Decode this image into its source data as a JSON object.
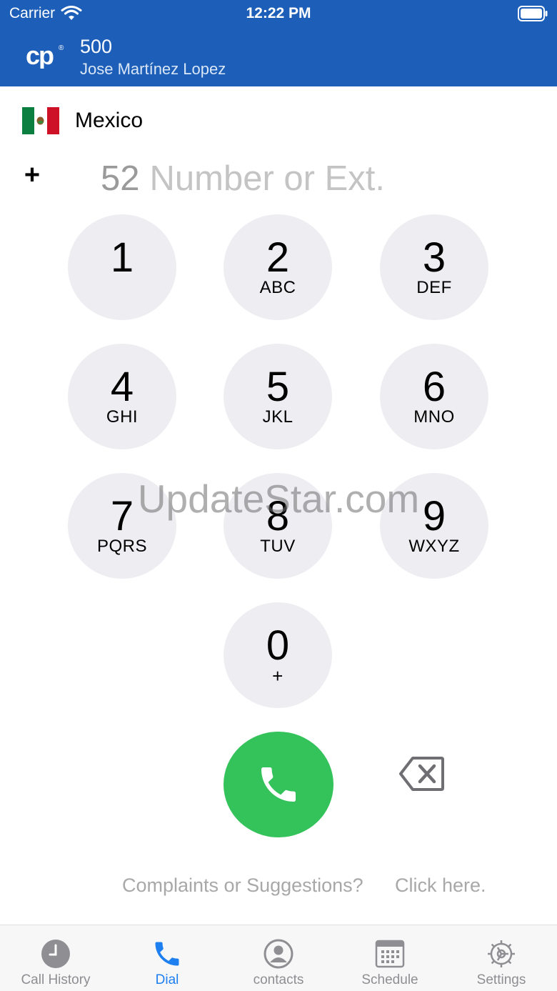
{
  "status_bar": {
    "carrier": "Carrier",
    "time": "12:22 PM"
  },
  "account": {
    "extension": "500",
    "name": "Jose Martínez Lopez"
  },
  "country": {
    "name": "Mexico",
    "code": "52",
    "flag_colors": [
      "#0a7f3f",
      "#ffffff",
      "#ce1126"
    ]
  },
  "dialer": {
    "plus_symbol": "+",
    "placeholder": "Number or Ext.",
    "value": ""
  },
  "keypad": [
    {
      "digit": "1",
      "letters": ""
    },
    {
      "digit": "2",
      "letters": "ABC"
    },
    {
      "digit": "3",
      "letters": "DEF"
    },
    {
      "digit": "4",
      "letters": "GHI"
    },
    {
      "digit": "5",
      "letters": "JKL"
    },
    {
      "digit": "6",
      "letters": "MNO"
    },
    {
      "digit": "7",
      "letters": "PQRS"
    },
    {
      "digit": "8",
      "letters": "TUV"
    },
    {
      "digit": "9",
      "letters": "WXYZ"
    },
    {
      "digit": "0",
      "letters": "+"
    }
  ],
  "feedback": {
    "question": "Complaints or Suggestions?",
    "link": "Click here."
  },
  "watermark": "UpdateStar.com",
  "tabs": [
    {
      "label": "Call History",
      "icon": "clock-icon",
      "active": false
    },
    {
      "label": "Dial",
      "icon": "phone-icon",
      "active": true
    },
    {
      "label": "contacts",
      "icon": "person-circle-icon",
      "active": false
    },
    {
      "label": "Schedule",
      "icon": "calendar-icon",
      "active": false
    },
    {
      "label": "Settings",
      "icon": "gear-icon",
      "active": false
    }
  ],
  "colors": {
    "header": "#1d5fb8",
    "call_button": "#33c35a",
    "key_background": "#eeeef2",
    "tab_active": "#1d7ff0",
    "tab_inactive": "#8e8e93"
  }
}
